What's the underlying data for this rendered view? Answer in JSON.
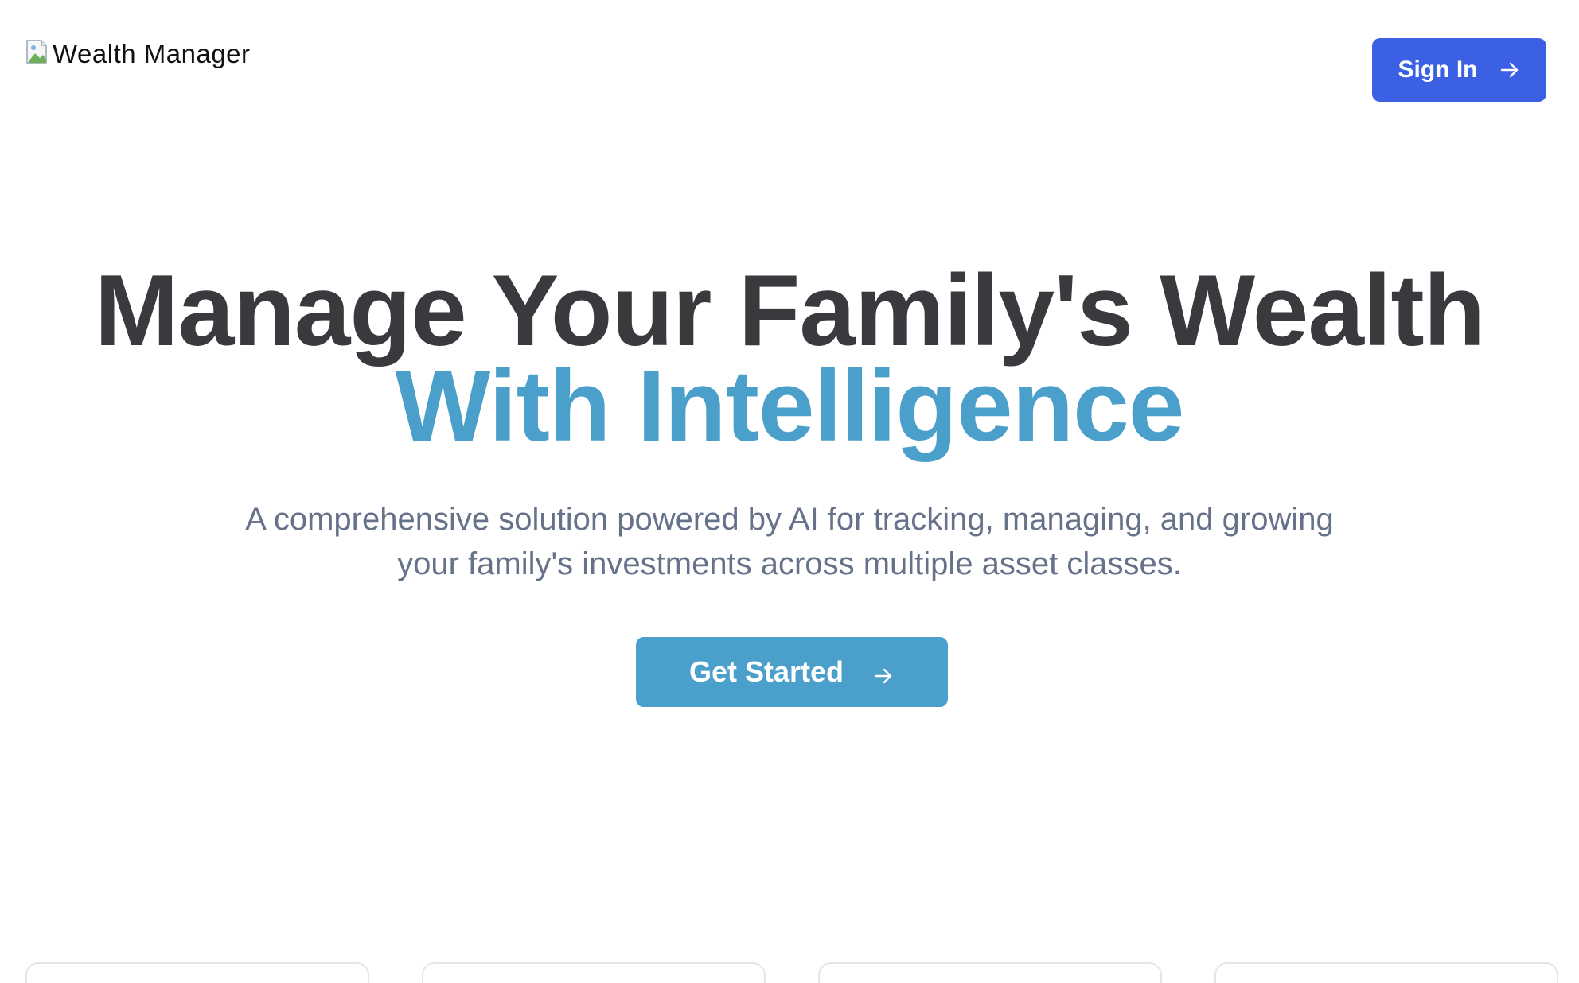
{
  "header": {
    "logo_alt": "Wealth Manager",
    "logo_icon": "broken-image-icon",
    "signin_label": "Sign In",
    "signin_icon": "arrow-right-icon"
  },
  "hero": {
    "title_line1": "Manage Your Family's Wealth",
    "title_line2": "With Intelligence",
    "subtitle": "A comprehensive solution powered by AI for tracking, managing, and growing your family's investments across multiple asset classes.",
    "cta_label": "Get Started",
    "cta_icon": "arrow-right-icon"
  },
  "colors": {
    "primary_blue": "#3b60e4",
    "accent_teal": "#4a9fcb",
    "heading": "#3a393e",
    "subtext": "#66718a",
    "card_border": "#e3e6ea"
  },
  "feature_cards_count": 4
}
